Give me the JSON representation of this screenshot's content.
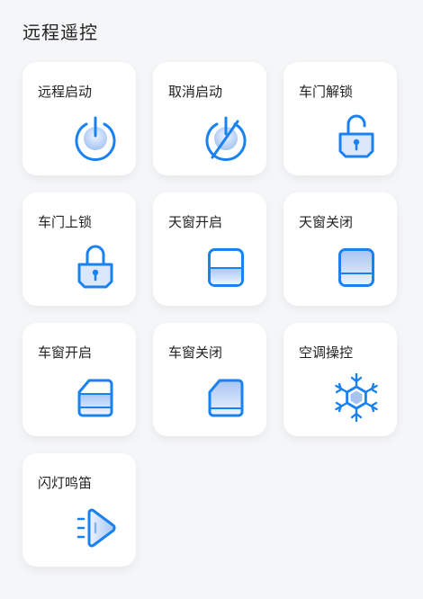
{
  "page": {
    "title": "远程遥控"
  },
  "colors": {
    "accent": "#1a82f0",
    "fill_light": "#dbe8fc",
    "fill_mid": "#a6c4f2",
    "background": "#f5f6f8",
    "tile": "#ffffff"
  },
  "controls": [
    {
      "label": "远程启动",
      "icon": "power-icon"
    },
    {
      "label": "取消启动",
      "icon": "power-off-icon"
    },
    {
      "label": "车门解锁",
      "icon": "unlock-icon"
    },
    {
      "label": "车门上锁",
      "icon": "lock-icon"
    },
    {
      "label": "天窗开启",
      "icon": "sunroof-open-icon"
    },
    {
      "label": "天窗关闭",
      "icon": "sunroof-close-icon"
    },
    {
      "label": "车窗开启",
      "icon": "window-open-icon"
    },
    {
      "label": "车窗关闭",
      "icon": "window-close-icon"
    },
    {
      "label": "空调操控",
      "icon": "snowflake-icon"
    },
    {
      "label": "闪灯鸣笛",
      "icon": "flash-horn-icon"
    }
  ]
}
